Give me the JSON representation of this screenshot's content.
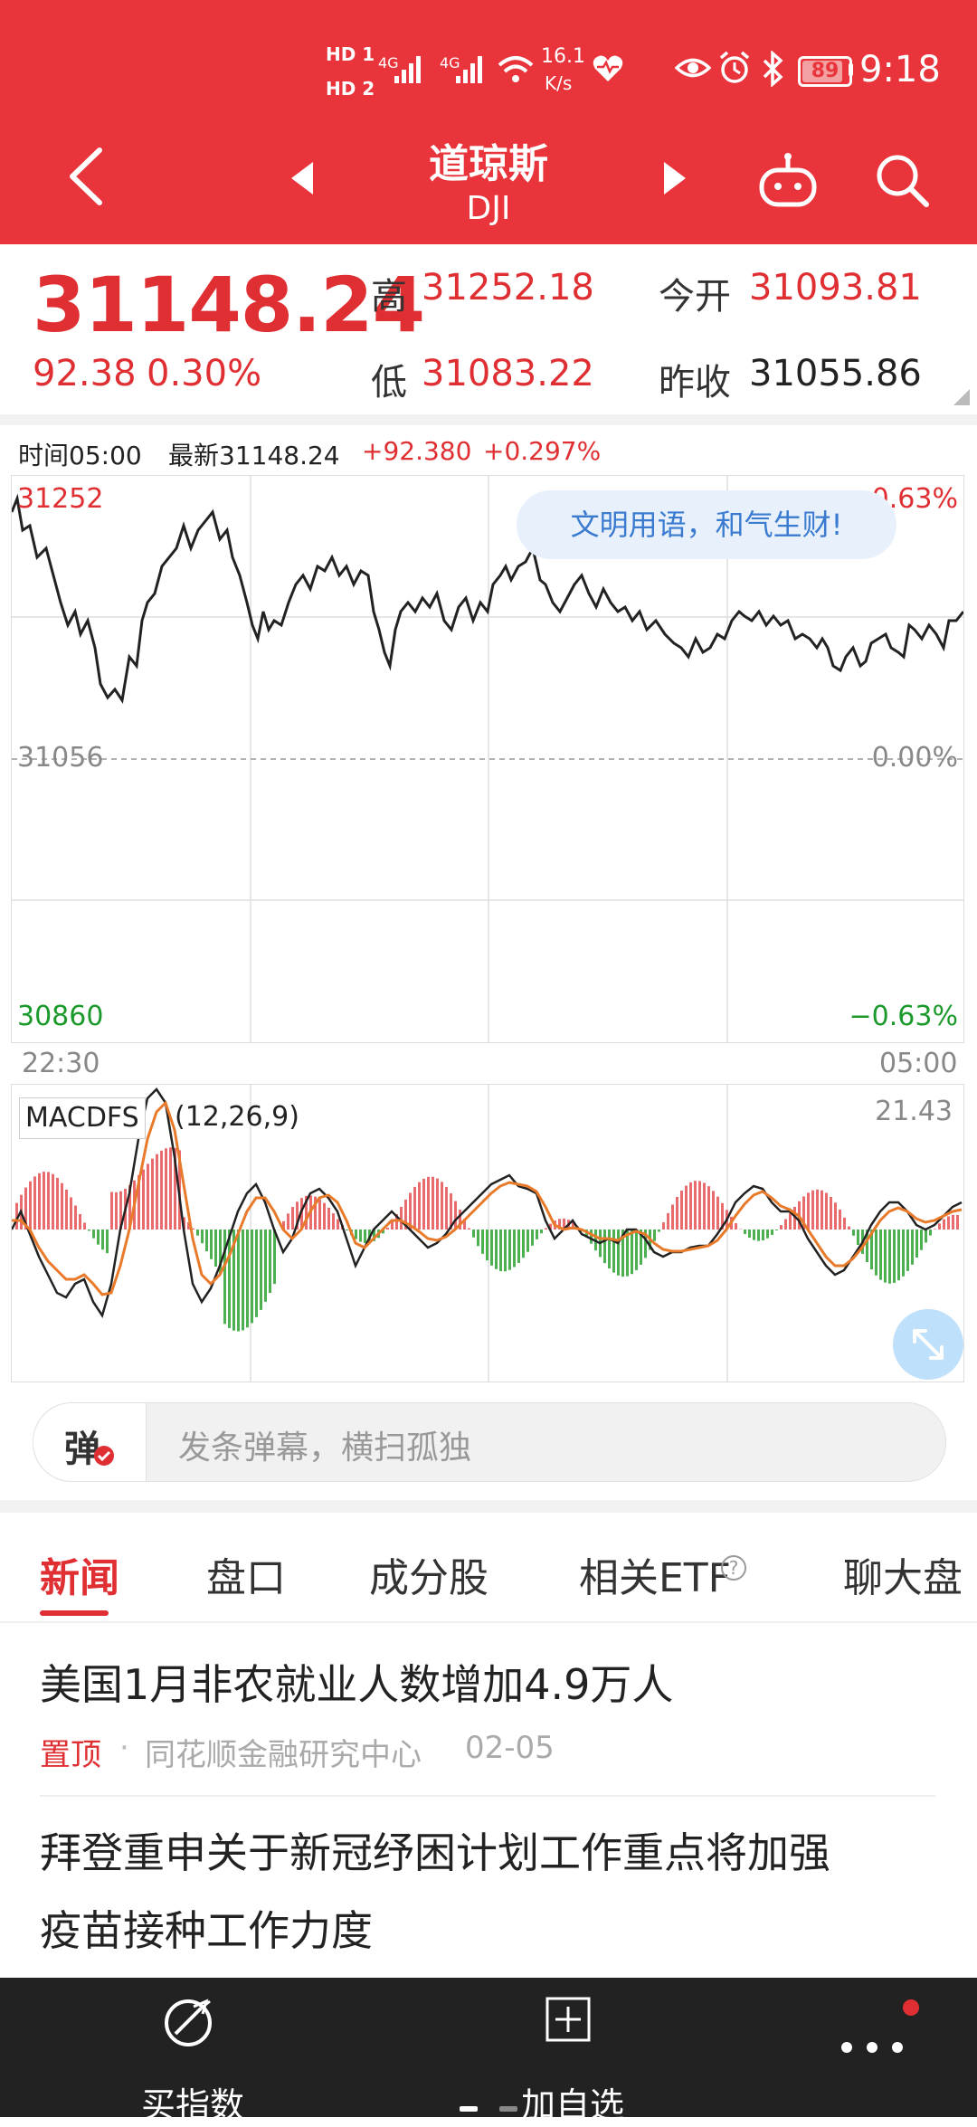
{
  "status_bar": {
    "hd1": "HD 1",
    "hd2": "HD 2",
    "net1": "4G",
    "net2": "4G",
    "speed_value": "16.1",
    "speed_unit": "K/s",
    "battery": "89",
    "time": "9:18"
  },
  "header": {
    "title": "道琼斯",
    "subtitle": "DJI"
  },
  "quote": {
    "price": "31148.24",
    "change": "92.38",
    "change_pct": "0.30%",
    "high_label": "高",
    "high": "31252.18",
    "low_label": "低",
    "low": "31083.22",
    "open_label": "今开",
    "open": "31093.81",
    "prev_close_label": "昨收",
    "prev_close": "31055.86"
  },
  "chart_info": {
    "time_label": "时间05:00",
    "latest_label": "最新31148.24",
    "change": "+92.380",
    "change_pct": "+0.297%"
  },
  "chart": {
    "y_top": "31252",
    "y_mid": "31056",
    "y_bottom": "30860",
    "pct_top": "+0.63%",
    "pct_mid": "0.00%",
    "pct_bottom": "−0.63%",
    "x_start": "22:30",
    "x_end": "05:00",
    "bubble": "文明用语，和气生财!"
  },
  "macd": {
    "label": "MACDFS",
    "params": "(12,26,9)",
    "value": "21.43"
  },
  "danmu": {
    "badge": "弹",
    "placeholder": "发条弹幕，横扫孤独"
  },
  "tabs": [
    {
      "label": "新闻"
    },
    {
      "label": "盘口"
    },
    {
      "label": "成分股"
    },
    {
      "label": "相关ETF"
    },
    {
      "label": "聊大盘"
    }
  ],
  "news": [
    {
      "title": "美国1月非农就业人数增加4.9万人",
      "tag": "置顶",
      "source": "同花顺金融研究中心",
      "date": "02-05"
    },
    {
      "title_line1": "拜登重申关于新冠纾困计划工作重点将加强",
      "title_line2": "疫苗接种工作力度"
    }
  ],
  "bottom_bar": {
    "buy_label": "买指数",
    "add_label": "加自选"
  },
  "colors": {
    "brand_red": "#e8343a",
    "up_red": "#e02f33",
    "down_green": "#1b9a2b"
  }
}
